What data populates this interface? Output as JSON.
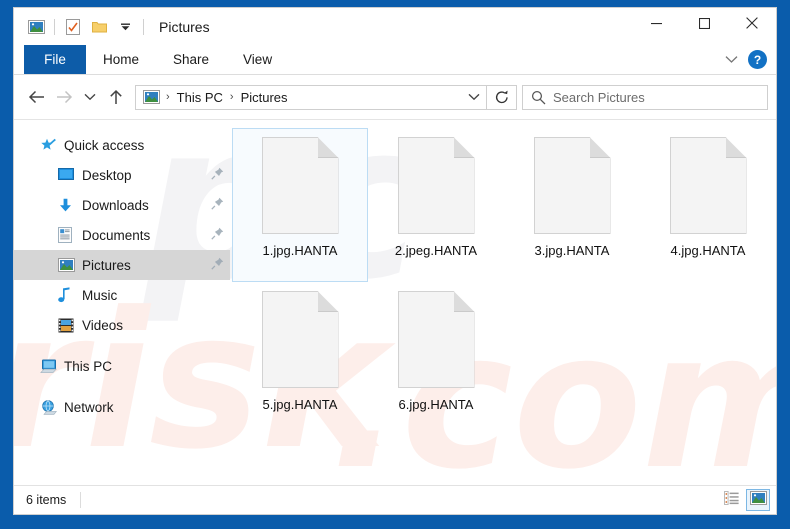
{
  "window": {
    "title": "Pictures",
    "quick_access_icons": [
      "picture-icon",
      "properties-icon",
      "new-folder-icon",
      "customize-qat-dropdown-icon"
    ],
    "controls": {
      "minimize": "–",
      "maximize": "□",
      "close": "✕"
    }
  },
  "ribbon": {
    "tabs": [
      {
        "label": "File",
        "active": true
      },
      {
        "label": "Home",
        "active": false
      },
      {
        "label": "Share",
        "active": false
      },
      {
        "label": "View",
        "active": false
      }
    ],
    "expand_icon": "chevron-down-icon",
    "help_label": "?"
  },
  "navbar": {
    "back_icon": "arrow-left-icon",
    "forward_icon": "arrow-right-icon",
    "recent_icon": "chevron-down-icon",
    "up_icon": "arrow-up-icon",
    "breadcrumb": {
      "root_icon": "pictures-folder-icon",
      "items": [
        "This PC",
        "Pictures"
      ],
      "separator": "›",
      "dropdown_icon": "chevron-down-icon"
    },
    "refresh_icon": "refresh-icon"
  },
  "search": {
    "icon": "search-icon",
    "placeholder": "Search Pictures",
    "value": ""
  },
  "sidebar": {
    "groups": [
      {
        "header": {
          "label": "Quick access",
          "icon": "star-pin-icon",
          "selected": false
        },
        "items": [
          {
            "label": "Desktop",
            "icon": "desktop-icon",
            "pinned": true,
            "selected": false
          },
          {
            "label": "Downloads",
            "icon": "downloads-icon",
            "pinned": true,
            "selected": false
          },
          {
            "label": "Documents",
            "icon": "documents-icon",
            "pinned": true,
            "selected": false
          },
          {
            "label": "Pictures",
            "icon": "pictures-icon",
            "pinned": true,
            "selected": true
          },
          {
            "label": "Music",
            "icon": "music-icon",
            "pinned": false,
            "selected": false
          },
          {
            "label": "Videos",
            "icon": "videos-icon",
            "pinned": false,
            "selected": false
          }
        ]
      },
      {
        "header": {
          "label": "This PC",
          "icon": "this-pc-icon",
          "selected": false
        },
        "items": []
      },
      {
        "header": {
          "label": "Network",
          "icon": "network-icon",
          "selected": false
        },
        "items": []
      }
    ]
  },
  "files": [
    {
      "name": "1.jpg.HANTA",
      "icon": "blank-document-icon",
      "selected": true
    },
    {
      "name": "2.jpeg.HANTA",
      "icon": "blank-document-icon",
      "selected": false
    },
    {
      "name": "3.jpg.HANTA",
      "icon": "blank-document-icon",
      "selected": false
    },
    {
      "name": "4.jpg.HANTA",
      "icon": "blank-document-icon",
      "selected": false
    },
    {
      "name": "5.jpg.HANTA",
      "icon": "blank-document-icon",
      "selected": false
    },
    {
      "name": "6.jpg.HANTA",
      "icon": "blank-document-icon",
      "selected": false
    }
  ],
  "statusbar": {
    "item_count": "6 items",
    "views": [
      {
        "name": "details-view-button",
        "icon": "details-view-icon",
        "active": false
      },
      {
        "name": "large-icons-view-button",
        "icon": "large-icons-view-icon",
        "active": true
      }
    ]
  },
  "watermark": {
    "part1": "pc",
    "part2": "risk",
    "part3": ".com"
  },
  "colors": {
    "frame_blue": "#0a5cab",
    "file_tab_blue": "#0d5ca8",
    "selection_border": "#bcdcf4",
    "selection_fill": "#f7fbfe",
    "sidebar_selected": "#d6d6d6",
    "help_blue": "#1271c4"
  }
}
